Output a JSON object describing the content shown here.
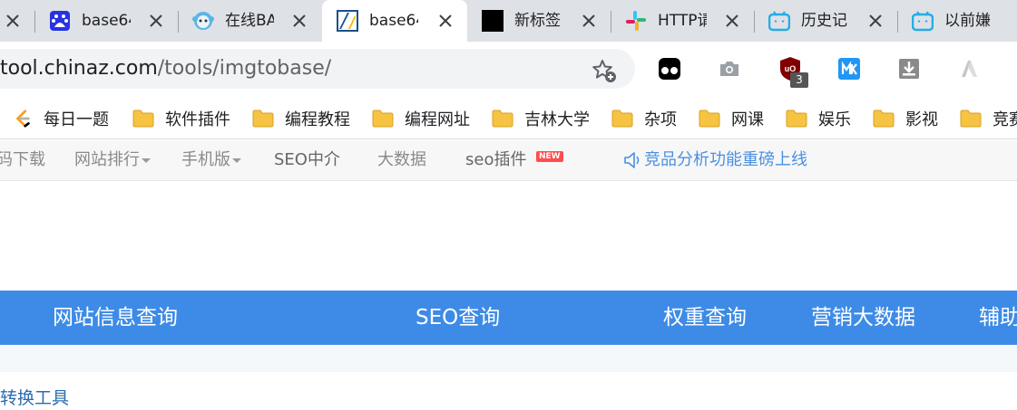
{
  "tabs": [
    {
      "title": "base64",
      "icon": "baidu-icon",
      "active": false
    },
    {
      "title": "在线BA",
      "icon": "monkey-icon",
      "active": false
    },
    {
      "title": "base64",
      "icon": "chinaz-icon",
      "active": true
    },
    {
      "title": "新标签",
      "icon": "black-square-icon",
      "active": false
    },
    {
      "title": "HTTP请",
      "icon": "slack-icon",
      "active": false
    },
    {
      "title": "历史记",
      "icon": "bilibili-icon",
      "active": false
    },
    {
      "title": "以前嫌",
      "icon": "bilibili-icon",
      "active": false
    }
  ],
  "address": {
    "host": "tool.chinaz.com",
    "path": "/tools/imgtobase/"
  },
  "extensions": [
    {
      "name": "tampermonkey-icon"
    },
    {
      "name": "camera-icon"
    },
    {
      "name": "ublock-icon",
      "badge": "3"
    },
    {
      "name": "mk-icon"
    },
    {
      "name": "download-icon"
    },
    {
      "name": "ai-logo-icon"
    }
  ],
  "bookmarks": [
    {
      "label": "每日一题",
      "icon": "leetcode-icon"
    },
    {
      "label": "软件插件",
      "icon": "folder-icon"
    },
    {
      "label": "编程教程",
      "icon": "folder-icon"
    },
    {
      "label": "编程网址",
      "icon": "folder-icon"
    },
    {
      "label": "吉林大学",
      "icon": "folder-icon"
    },
    {
      "label": "杂项",
      "icon": "folder-icon"
    },
    {
      "label": "网课",
      "icon": "folder-icon"
    },
    {
      "label": "娱乐",
      "icon": "folder-icon"
    },
    {
      "label": "影视",
      "icon": "folder-icon"
    },
    {
      "label": "竞赛",
      "icon": "folder-icon"
    }
  ],
  "site_nav": {
    "download": "码下载",
    "ranking": "网站排行",
    "mobile": "手机版",
    "seo_agent": "SEO中介",
    "bigdata": "大数据",
    "seo_plugin": "seo插件",
    "new_badge": "NEW",
    "notice": "竞品分析功能重磅上线"
  },
  "category_bar": {
    "site_info": "网站信息查询",
    "seo": "SEO查询",
    "weight": "权重查询",
    "marketing": "营销大数据",
    "assist": "辅助"
  },
  "breadcrumb": "转换工具",
  "colors": {
    "tab_strip": "#dee1e6",
    "blue_bar": "#3d8be6",
    "notice": "#4a90e2",
    "new_badge": "#ff4d4d",
    "folder": "#f6c343"
  }
}
